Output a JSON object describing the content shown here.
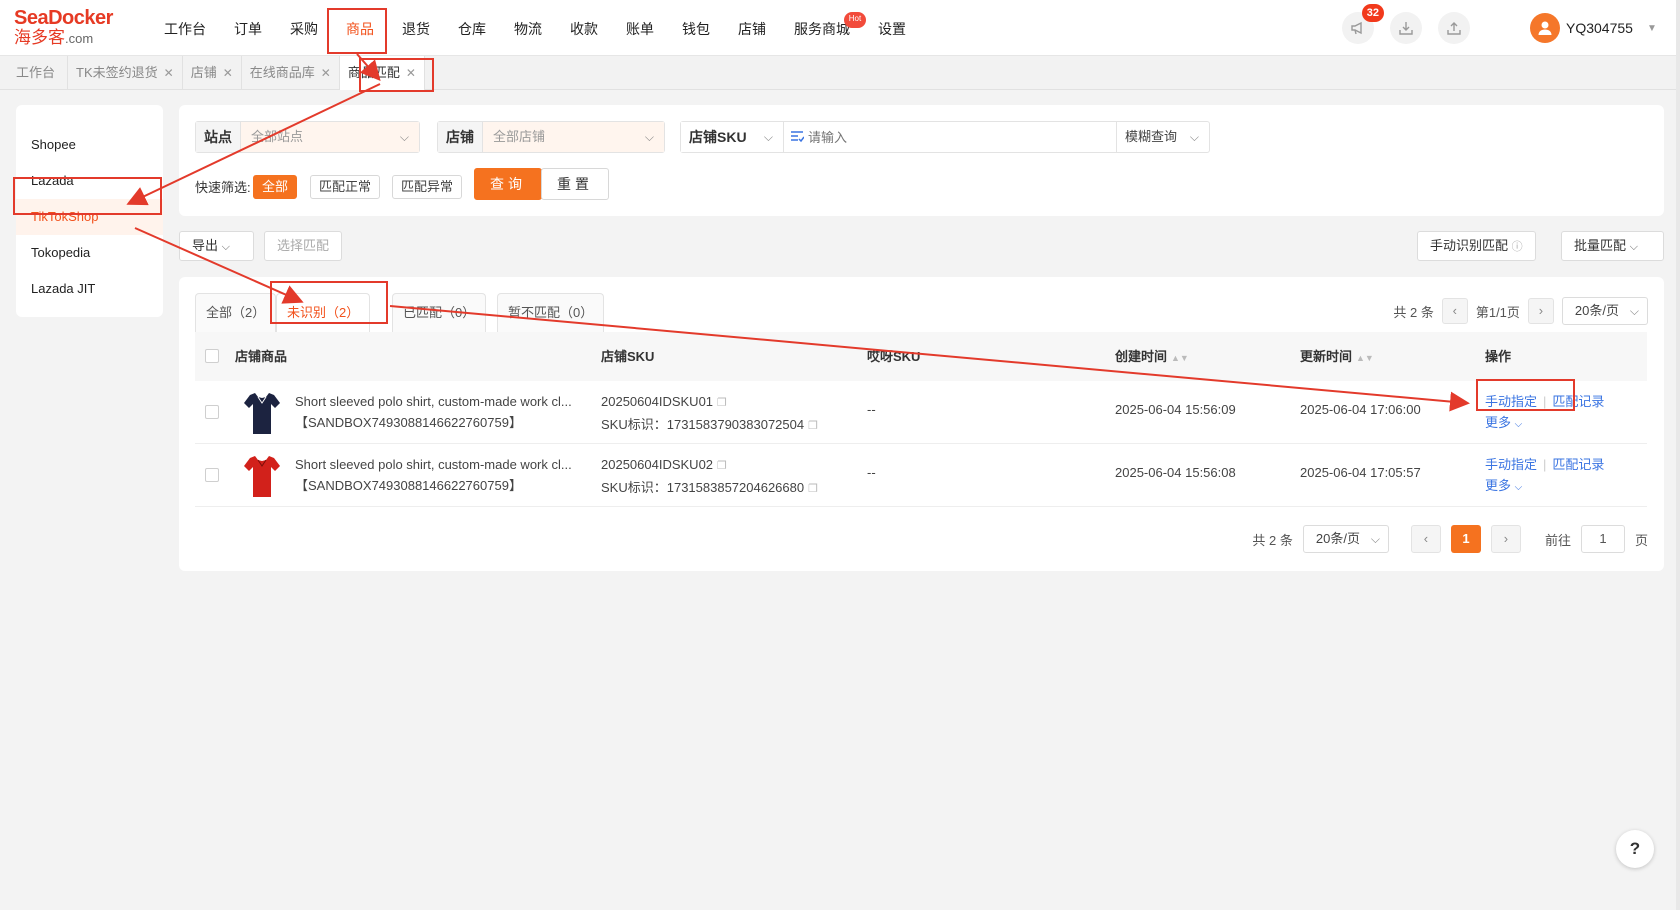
{
  "brand": {
    "name_top": "SeaDocker",
    "name_bottom": "海多客",
    "domain": ".com",
    "color": "#e63a24"
  },
  "nav": [
    {
      "label": "工作台"
    },
    {
      "label": "订单"
    },
    {
      "label": "采购"
    },
    {
      "label": "商品",
      "active": true
    },
    {
      "label": "退货"
    },
    {
      "label": "仓库"
    },
    {
      "label": "物流"
    },
    {
      "label": "收款"
    },
    {
      "label": "账单"
    },
    {
      "label": "钱包"
    },
    {
      "label": "店铺"
    },
    {
      "label": "服务商城"
    },
    {
      "label": "设置"
    }
  ],
  "hot_badge": "Hot",
  "notifications": {
    "count": "32"
  },
  "user": {
    "name": "YQ304755"
  },
  "page_tabs": [
    {
      "label": "工作台"
    },
    {
      "label": "TK未签约退货"
    },
    {
      "label": "店铺"
    },
    {
      "label": "在线商品库"
    },
    {
      "label": "商品匹配"
    }
  ],
  "platforms": [
    "Shopee",
    "Lazada",
    "TikTokShop",
    "Tokopedia",
    "Lazada JIT"
  ],
  "filters": {
    "site_label": "站点",
    "site_value": "全部站点",
    "store_label": "店铺",
    "store_value": "全部店铺",
    "sku_label": "店铺SKU",
    "sku_placeholder": "请输入",
    "match_mode": "模糊查询",
    "quick_label": "快速筛选:",
    "quick": [
      "全部",
      "匹配正常",
      "匹配异常"
    ],
    "query": "查询",
    "reset": "重置"
  },
  "actions": {
    "export": "导出",
    "select_match": "选择匹配",
    "manual_identify": "手动识别匹配",
    "batch_match": "批量匹配"
  },
  "status_tabs": [
    {
      "label": "全部（2）"
    },
    {
      "label": "未识别（2）"
    },
    {
      "label": "已匹配（0）"
    },
    {
      "label": "暂不匹配（0）"
    }
  ],
  "pager_top": {
    "total": "共 2 条",
    "page": "第1/1页",
    "per_page": "20条/页"
  },
  "columns": [
    "店铺商品",
    "店铺SKU",
    "哎呀SKU",
    "创建时间",
    "更新时间",
    "操作"
  ],
  "rows": [
    {
      "name": "Short sleeved polo shirt, custom-made work cl...",
      "code": "【SANDBOX7493088146622760759】",
      "sku": "20250604IDSKU01",
      "sku_id": "SKU标识：1731583790383072504",
      "ay_sku": "--",
      "created": "2025-06-04 15:56:09",
      "updated": "2025-06-04 17:06:00",
      "color": "#1c2340"
    },
    {
      "name": "Short sleeved polo shirt, custom-made work cl...",
      "code": "【SANDBOX7493088146622760759】",
      "sku": "20250604IDSKU02",
      "sku_id": "SKU标识：1731583857204626680",
      "ay_sku": "--",
      "created": "2025-06-04 15:56:08",
      "updated": "2025-06-04 17:05:57",
      "color": "#d2211b"
    }
  ],
  "row_actions": {
    "manual": "手动指定",
    "record": "匹配记录",
    "more": "更多"
  },
  "pager_bottom": {
    "total": "共 2 条",
    "per_page": "20条/页",
    "current": "1",
    "goto_label": "前往",
    "goto_value": "1",
    "page_suffix": "页"
  },
  "help": "?",
  "accent": "#f5721f",
  "link_color": "#3a74e2",
  "annotation_color": "#e33a2b"
}
